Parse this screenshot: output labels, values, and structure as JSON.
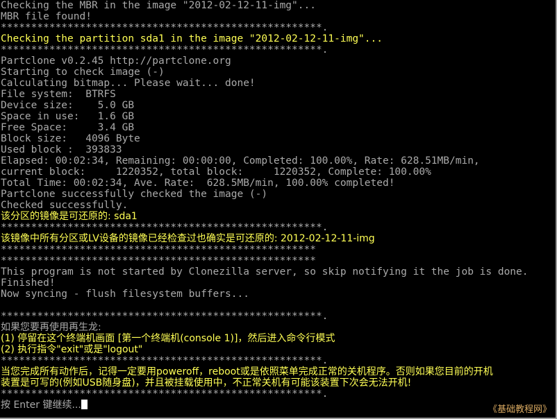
{
  "terminal": {
    "background_color": "#000000",
    "default_text_color": "#aaaaaa",
    "highlight_text_color": "#ffff55",
    "cursor_color": "#ffffff",
    "watermark_color": "#d8a860"
  },
  "lines": [
    {
      "id": "l01",
      "text": "Checking the MBR in the image \"2012-02-12-11-img\"...",
      "color": "grey",
      "script": "latin"
    },
    {
      "id": "l02",
      "text": "MBR file found!",
      "color": "grey",
      "script": "latin"
    },
    {
      "id": "l03",
      "text": "*****************************************************.",
      "color": "grey",
      "script": "latin"
    },
    {
      "id": "l04",
      "text": "Checking the partition sda1 in the image \"2012-02-12-11-img\"...",
      "color": "yellow",
      "script": "latin"
    },
    {
      "id": "l05",
      "text": "*****************************************************.",
      "color": "grey",
      "script": "latin"
    },
    {
      "id": "l06",
      "text": "Partclone v0.2.45 http://partclone.org",
      "color": "grey",
      "script": "latin"
    },
    {
      "id": "l07",
      "text": "Starting to check image (-)",
      "color": "grey",
      "script": "latin"
    },
    {
      "id": "l08",
      "text": "Calculating bitmap... Please wait... done!",
      "color": "grey",
      "script": "latin"
    },
    {
      "id": "l09",
      "text": "File system:  BTRFS",
      "color": "grey",
      "script": "latin"
    },
    {
      "id": "l10",
      "text": "Device size:    5.0 GB",
      "color": "grey",
      "script": "latin"
    },
    {
      "id": "l11",
      "text": "Space in use:   1.6 GB",
      "color": "grey",
      "script": "latin"
    },
    {
      "id": "l12",
      "text": "Free Space:     3.4 GB",
      "color": "grey",
      "script": "latin"
    },
    {
      "id": "l13",
      "text": "Block size:   4096 Byte",
      "color": "grey",
      "script": "latin"
    },
    {
      "id": "l14",
      "text": "Used block :  393833",
      "color": "grey",
      "script": "latin"
    },
    {
      "id": "l15",
      "text": "Elapsed: 00:02:34, Remaining: 00:00:00, Completed: 100.00%, Rate: 628.51MB/min,",
      "color": "grey",
      "script": "latin"
    },
    {
      "id": "l16",
      "text": "current block:     1220352, total block:     1220352, Complete: 100.00%",
      "color": "grey",
      "script": "latin"
    },
    {
      "id": "l17",
      "text": "Total Time: 00:02:34, Ave. Rate:  628.5MB/min, 100.00% completed!",
      "color": "grey",
      "script": "latin"
    },
    {
      "id": "l18",
      "text": "Partclone successfully checked the image (-)",
      "color": "grey",
      "script": "latin"
    },
    {
      "id": "l19",
      "text": "Checked successfully.",
      "color": "grey",
      "script": "latin"
    },
    {
      "id": "l20",
      "text": "该分区的镜像是可还原的: sda1",
      "color": "yellow",
      "script": "cjk"
    },
    {
      "id": "l21",
      "text": "*****************************************************.",
      "color": "grey",
      "script": "latin"
    },
    {
      "id": "l22",
      "text": "该镜像中所有分区或LV设备的镜像已经检查过也确实是可还原的: 2012-02-12-11-img",
      "color": "yellow",
      "script": "cjk"
    },
    {
      "id": "l23",
      "text": "****************************************************",
      "color": "grey",
      "script": "latin"
    },
    {
      "id": "l24",
      "text": "****************************************************",
      "color": "grey",
      "script": "latin"
    },
    {
      "id": "l25",
      "text": "This program is not started by Clonezilla server, so skip notifying it the job is done.",
      "color": "grey",
      "script": "latin"
    },
    {
      "id": "l26",
      "text": "Finished!",
      "color": "grey",
      "script": "latin"
    },
    {
      "id": "l27",
      "text": "Now syncing - flush filesystem buffers...",
      "color": "grey",
      "script": "latin"
    },
    {
      "id": "l28",
      "text": "",
      "color": "blank",
      "script": "latin"
    },
    {
      "id": "l29",
      "text": "*****************************************************.",
      "color": "grey",
      "script": "latin"
    },
    {
      "id": "l30",
      "text": "如果您要再使用再生龙:",
      "color": "grey",
      "script": "cjk"
    },
    {
      "id": "l31",
      "text": "(1) 停留在这个终端机画面 [第一个终端机(console 1)]，然后进入命令行模式",
      "color": "yellow",
      "script": "cjk"
    },
    {
      "id": "l32",
      "text": "(2) 执行指令\"exit\"或是\"logout\"",
      "color": "yellow",
      "script": "cjk"
    },
    {
      "id": "l33",
      "text": "*****************************************************.",
      "color": "grey",
      "script": "latin"
    },
    {
      "id": "l34",
      "text": "当您完成所有动作后，记得一定要用poweroff，reboot或是依照菜单完成正常的关机程序。否则如果您目前的开机",
      "color": "yellow",
      "script": "cjk"
    },
    {
      "id": "l35",
      "text": "装置是可写的(例如USB随身盘)，并且被挂载使用中，不正常关机有可能该装置下次会无法开机!",
      "color": "yellow",
      "script": "cjk"
    },
    {
      "id": "l36",
      "text": "*****************************************************.",
      "color": "grey",
      "script": "latin"
    },
    {
      "id": "l37",
      "text": "按 Enter 键继续...",
      "color": "grey",
      "script": "cjk",
      "cursor": true
    }
  ],
  "watermark": {
    "text": "《基础教程网》"
  }
}
